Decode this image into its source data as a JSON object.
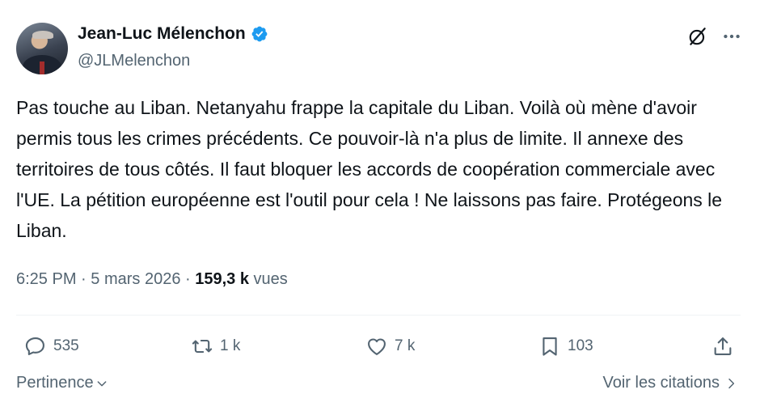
{
  "author": {
    "display_name": "Jean-Luc Mélenchon",
    "handle": "@JLMelenchon",
    "verified": true,
    "verified_color": "#1d9bf0"
  },
  "tweet": {
    "text": "Pas touche au Liban. Netanyahu frappe la capitale du Liban. Voilà où mène d'avoir permis tous les crimes précédents. Ce pouvoir-là n'a plus de limite. Il annexe des territoires de tous côtés. Il faut bloquer les accords de coopération commerciale avec l'UE. La pétition européenne est l'outil pour cela ! Ne laissons pas faire. Protégeons le Liban.",
    "time": "6:25 PM",
    "separator": " · ",
    "date": "5 mars 2026",
    "views_count": "159,3 k",
    "views_label": " vues"
  },
  "actions": {
    "replies": "535",
    "retweets": "1 k",
    "likes": "7 k",
    "bookmarks": "103"
  },
  "footer": {
    "sort_label": "Pertinence",
    "quotes_label": "Voir les citations"
  },
  "icons": {
    "header": [
      "grok-icon",
      "more-icon"
    ],
    "actions": [
      "reply-icon",
      "retweet-icon",
      "like-icon",
      "bookmark-icon",
      "share-icon"
    ]
  },
  "colors": {
    "text": "#0f1419",
    "secondary": "#536471",
    "divider": "#eff3f4"
  }
}
